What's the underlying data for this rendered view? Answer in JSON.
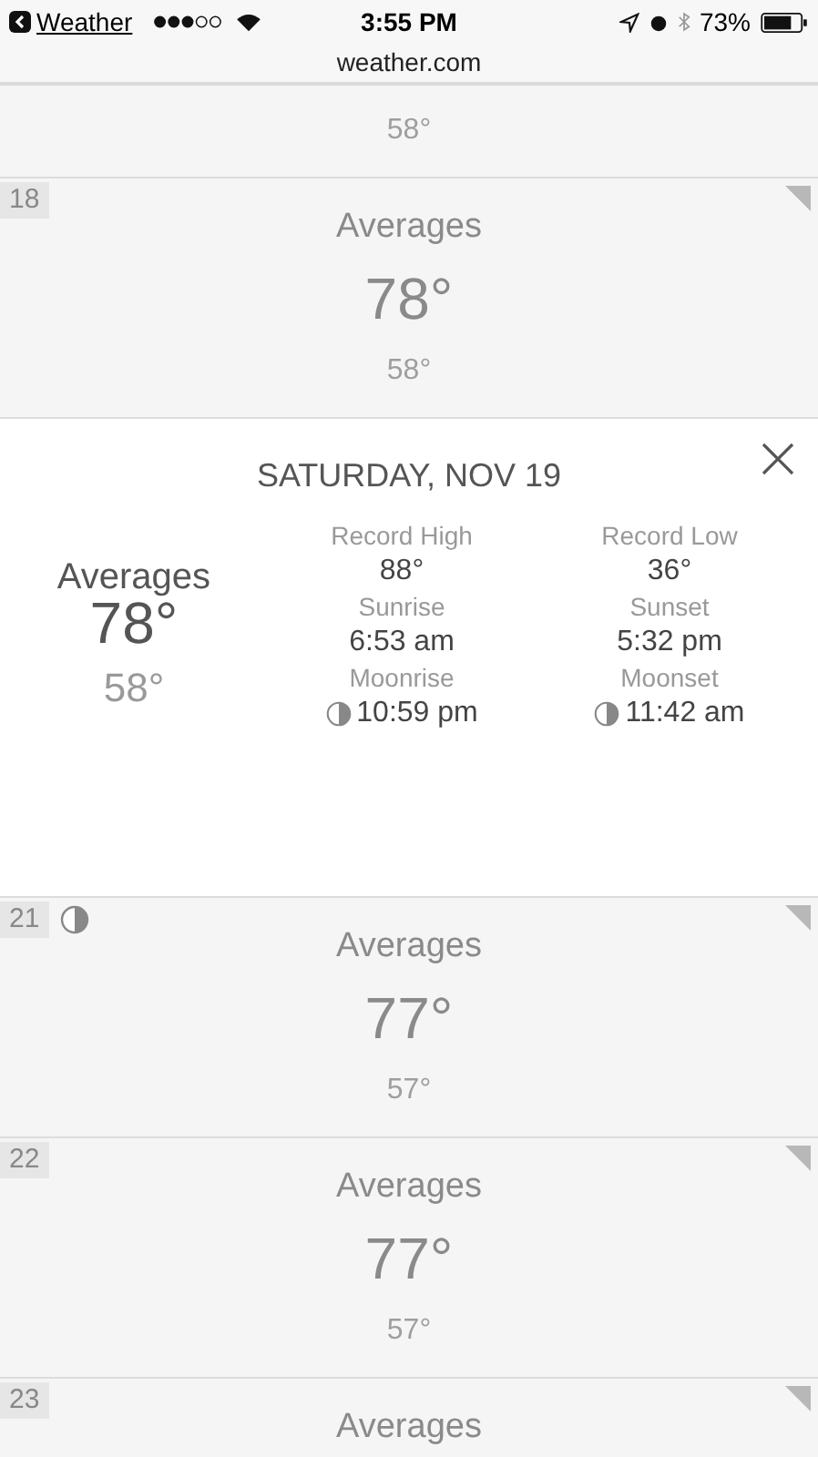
{
  "status_bar": {
    "back_label": "Weather",
    "time": "3:55 PM",
    "battery": "73%"
  },
  "url_bar": {
    "url": "weather.com"
  },
  "days": [
    {
      "kind": "partial",
      "low": "58°"
    },
    {
      "kind": "cell",
      "day": "18",
      "label": "Averages",
      "high": "78°",
      "low": "58°"
    },
    {
      "kind": "detail",
      "title": "SATURDAY, NOV 19",
      "label": "Averages",
      "high": "78°",
      "low": "58°",
      "columns": [
        [
          {
            "label": "Record High",
            "value": "88°",
            "moon": false
          },
          {
            "label": "Sunrise",
            "value": "6:53 am",
            "moon": false
          },
          {
            "label": "Moonrise",
            "value": "10:59 pm",
            "moon": true
          }
        ],
        [
          {
            "label": "Record Low",
            "value": "36°",
            "moon": false
          },
          {
            "label": "Sunset",
            "value": "5:32 pm",
            "moon": false
          },
          {
            "label": "Moonset",
            "value": "11:42 am",
            "moon": true
          }
        ]
      ]
    },
    {
      "kind": "cell",
      "day": "21",
      "moon": true,
      "label": "Averages",
      "high": "77°",
      "low": "57°"
    },
    {
      "kind": "cell",
      "day": "22",
      "label": "Averages",
      "high": "77°",
      "low": "57°"
    },
    {
      "kind": "cut",
      "day": "23",
      "label": "Averages"
    }
  ]
}
